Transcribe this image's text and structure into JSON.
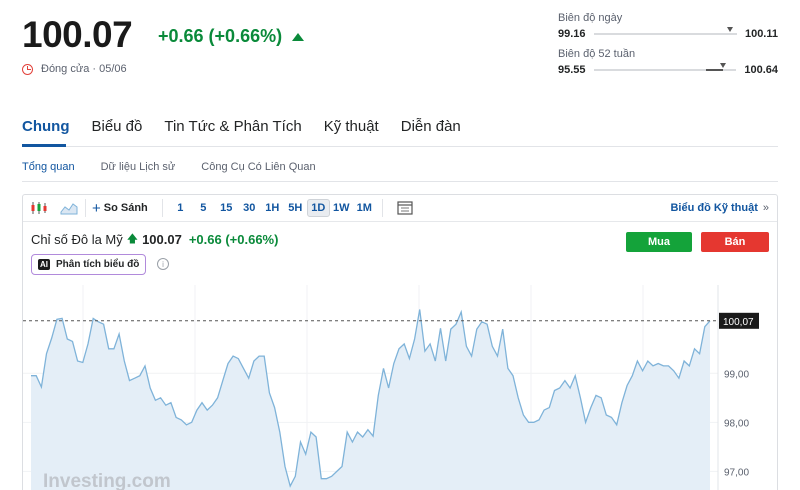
{
  "quote": {
    "price": "100.07",
    "change": "+0.66 (+0.66%)",
    "closed_label": "Đóng cửa · 05/06",
    "up_color": "#0a8a3a",
    "down_color": "#e53730"
  },
  "ranges": {
    "day": {
      "label": "Biên độ ngày",
      "low": "99.16",
      "high": "100.11",
      "marker": 0.95
    },
    "week52": {
      "label": "Biên độ 52 tuần",
      "low": "95.55",
      "high": "100.64",
      "marker": 0.91
    }
  },
  "tabs": [
    {
      "label": "Chung",
      "active": true
    },
    {
      "label": "Biểu đồ",
      "active": false
    },
    {
      "label": "Tin Tức & Phân Tích",
      "active": false
    },
    {
      "label": "Kỹ thuật",
      "active": false
    },
    {
      "label": "Diễn đàn",
      "active": false
    }
  ],
  "subtabs": [
    {
      "label": "Tổng quan",
      "active": true
    },
    {
      "label": "Dữ liệu Lịch sử",
      "active": false
    },
    {
      "label": "Công Cụ Có Liên Quan",
      "active": false
    }
  ],
  "toolbar": {
    "compare_label": "So Sánh",
    "timeframes": [
      {
        "label": "1",
        "active": false
      },
      {
        "label": "5",
        "active": false
      },
      {
        "label": "15",
        "active": false
      },
      {
        "label": "30",
        "active": false
      },
      {
        "label": "1H",
        "active": false
      },
      {
        "label": "5H",
        "active": false
      },
      {
        "label": "1D",
        "active": true
      },
      {
        "label": "1W",
        "active": false
      },
      {
        "label": "1M",
        "active": false
      }
    ],
    "technical_label": "Biểu đồ Kỹ thuật",
    "icons": [
      "candlestick-icon",
      "area-chart-icon",
      "plus-icon",
      "calendar-icon",
      "double-chevron-right-icon"
    ]
  },
  "instrument": {
    "name": "Chỉ số Đô la Mỹ",
    "price": "100.07",
    "change": "+0.66 (+0.66%)",
    "buy_label": "Mua",
    "sell_label": "Bán",
    "buy_color": "#14a33a",
    "sell_color": "#e53730",
    "ai_badge": "AI",
    "ai_label": "Phân tích biểu đồ"
  },
  "watermark": "Investing.com",
  "chart_data": {
    "type": "area",
    "series": [
      {
        "values": [
          98.95,
          98.95,
          98.72,
          99.4,
          99.72,
          100.1,
          100.12,
          99.7,
          99.65,
          99.25,
          99.22,
          99.6,
          100.12,
          100.05,
          100.0,
          99.5,
          99.5,
          99.8,
          99.25,
          98.85,
          98.9,
          98.95,
          99.15,
          98.7,
          98.45,
          98.5,
          98.35,
          98.4,
          98.1,
          98.05,
          97.95,
          98.0,
          98.25,
          98.4,
          98.25,
          98.35,
          98.5,
          98.85,
          99.2,
          99.35,
          99.3,
          99.1,
          98.9,
          99.25,
          99.35,
          99.35,
          98.6,
          98.3,
          97.8,
          97.1,
          96.7,
          96.9,
          97.6,
          97.35,
          97.8,
          97.7,
          96.85,
          96.85,
          96.9,
          97.0,
          97.1,
          97.8,
          97.6,
          97.8,
          97.7,
          97.85,
          97.72,
          98.55,
          99.1,
          98.7,
          99.2,
          99.5,
          99.6,
          99.3,
          99.7,
          100.3,
          99.45,
          99.6,
          99.25,
          99.92,
          99.25,
          99.9,
          100.0,
          100.25,
          99.55,
          99.35,
          99.9,
          100.05,
          100.0,
          99.55,
          99.35,
          99.9,
          99.1,
          98.95,
          98.5,
          98.15,
          98.0,
          98.0,
          98.05,
          98.25,
          98.3,
          98.65,
          98.7,
          98.85,
          98.7,
          98.95,
          98.5,
          98.0,
          98.3,
          98.55,
          98.5,
          98.15,
          98.1,
          97.95,
          98.4,
          98.75,
          98.95,
          99.25,
          99.05,
          99.25,
          99.15,
          99.2,
          99.15,
          99.15,
          99.05,
          98.9,
          99.25,
          99.15,
          99.5,
          99.4,
          99.95,
          100.07
        ]
      }
    ],
    "last_value": 100.07,
    "last_label": "100,07",
    "ylim": [
      96.6,
      100.8
    ],
    "yticks": [
      99.0,
      98.0,
      97.0
    ],
    "ytick_labels": [
      "99,00",
      "98,00",
      "97,00"
    ],
    "grid": true,
    "line_color": "#7fb3d9",
    "fill_color": "#e4eef7"
  }
}
